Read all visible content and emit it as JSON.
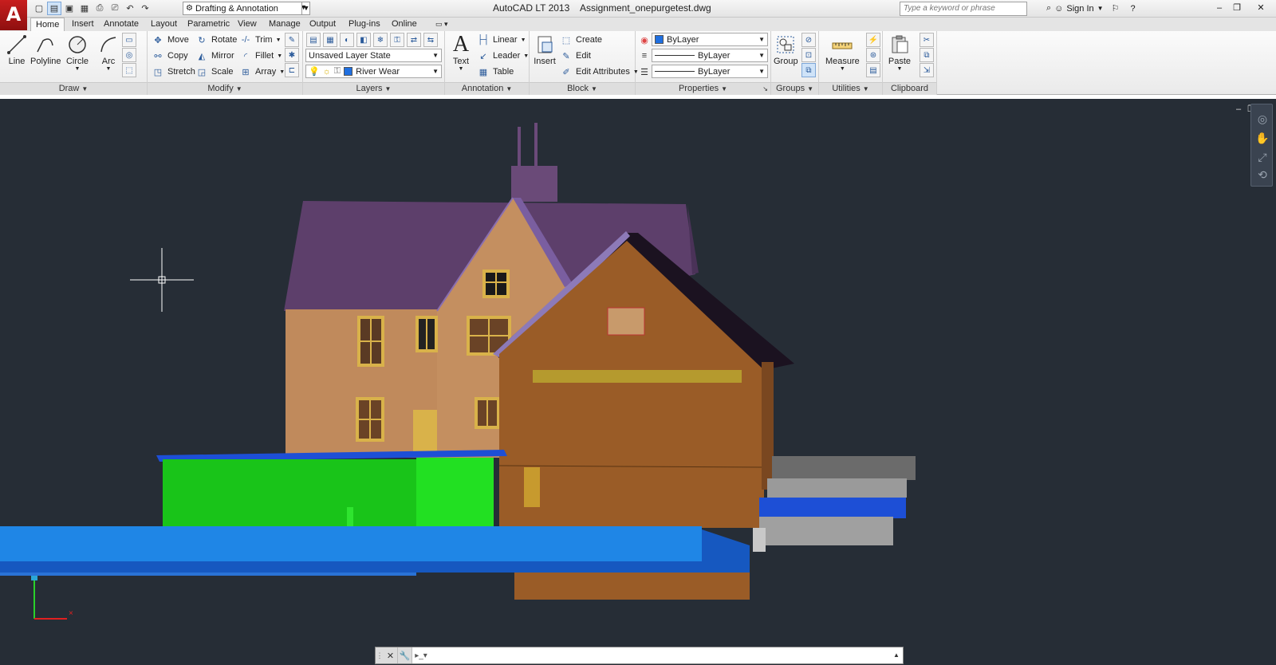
{
  "app": {
    "title": "AutoCAD LT 2013    Assignment_onepurgetest.dwg",
    "logo_letter": "A",
    "workspace": "Drafting & Annotation",
    "search_placeholder": "Type a keyword or phrase",
    "sign_in": "Sign In"
  },
  "tabs": [
    {
      "label": "Home",
      "active": true
    },
    {
      "label": "Insert"
    },
    {
      "label": "Annotate"
    },
    {
      "label": "Layout"
    },
    {
      "label": "Parametric"
    },
    {
      "label": "View"
    },
    {
      "label": "Manage"
    },
    {
      "label": "Output"
    },
    {
      "label": "Plug-ins"
    },
    {
      "label": "Online"
    }
  ],
  "ribbon": {
    "draw": {
      "title": "Draw",
      "line": "Line",
      "polyline": "Polyline",
      "circle": "Circle",
      "arc": "Arc"
    },
    "modify": {
      "title": "Modify",
      "move": "Move",
      "rotate": "Rotate",
      "trim": "Trim",
      "copy": "Copy",
      "mirror": "Mirror",
      "fillet": "Fillet",
      "stretch": "Stretch",
      "scale": "Scale",
      "array": "Array"
    },
    "layers": {
      "title": "Layers",
      "layer_state": "Unsaved Layer State",
      "current_layer": "River Wear",
      "current_layer_color": "#1f6fe0"
    },
    "annotation": {
      "title": "Annotation",
      "text": "Text",
      "linear": "Linear",
      "leader": "Leader",
      "table": "Table"
    },
    "block": {
      "title": "Block",
      "insert": "Insert",
      "create": "Create",
      "edit": "Edit",
      "edit_attributes": "Edit Attributes"
    },
    "properties": {
      "title": "Properties",
      "color": "ByLayer",
      "color_swatch": "#1f6fe0",
      "linetype": "ByLayer",
      "lineweight": "ByLayer"
    },
    "groups": {
      "title": "Groups",
      "group": "Group"
    },
    "utilities": {
      "title": "Utilities",
      "measure": "Measure"
    },
    "clipboard": {
      "title": "Clipboard",
      "paste": "Paste"
    }
  },
  "colors": {
    "canvas": "#262d36",
    "roof": "#5d3f6b",
    "wall_light": "#c08a5c",
    "wall_dark": "#9a5c27",
    "window": "#d9b24a",
    "hedge": "#19c419",
    "hedge_light": "#22e022",
    "river": "#1f86e6",
    "wall_blue": "#1d4fd6",
    "grey_block": "#9a9a9a"
  },
  "command_line": {
    "value": ""
  }
}
